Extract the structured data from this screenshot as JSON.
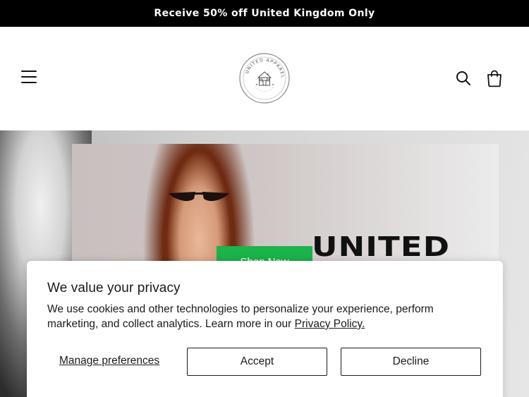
{
  "announcement": {
    "text": "Receive 50% off United Kingdom Only"
  },
  "header": {
    "menu_icon": "hamburger-menu-icon",
    "logo_icon": "united-apparel-house-logo",
    "logo_text_top": "UNITED APPAREL",
    "search_icon": "search-icon",
    "cart_icon": "shopping-bag-icon"
  },
  "hero": {
    "headline": "UNITED",
    "cta_label": "Shop Now",
    "cta_color": "#1cb34a"
  },
  "cookie_banner": {
    "title": "We value your privacy",
    "body": "We use cookies and other technologies to personalize your experience, perform marketing, and collect analytics. Learn more in our ",
    "policy_link": "Privacy Policy.",
    "manage_label": "Manage preferences",
    "accept_label": "Accept",
    "decline_label": "Decline"
  }
}
